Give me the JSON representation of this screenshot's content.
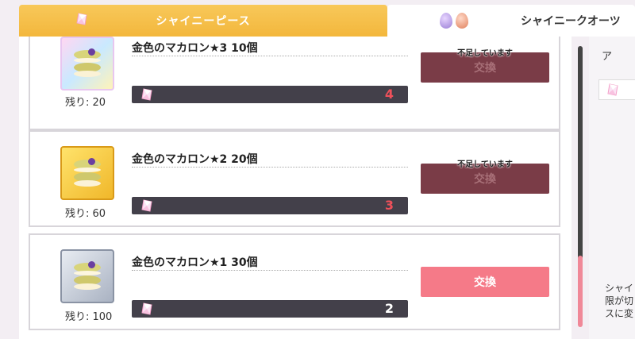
{
  "tabs": {
    "active_label": "シャイニーピース",
    "inactive_label": "シャイニークオーツ"
  },
  "items": [
    {
      "name": "金色のマカロン★3 10個",
      "remaining": "残り: 20",
      "cost": "4",
      "button_label": "交換",
      "shortage_label": "不足しています",
      "thumb_icon": "gold-macaron-3star-icon"
    },
    {
      "name": "金色のマカロン★2 20個",
      "remaining": "残り: 60",
      "cost": "3",
      "button_label": "交換",
      "shortage_label": "不足しています",
      "thumb_icon": "gold-macaron-2star-icon"
    },
    {
      "name": "金色のマカロン★1 30個",
      "remaining": "残り: 100",
      "cost": "2",
      "button_label": "交換",
      "thumb_icon": "gold-macaron-1star-icon"
    }
  ],
  "side": {
    "top_label": "ア",
    "text_line1": "シャイ",
    "text_line2": "限が切",
    "text_line3": "スに変"
  },
  "colors": {
    "tab_active": "#f3b73c",
    "button_enabled": "#f57a88",
    "button_disabled": "#7a3c47",
    "insufficient_cost": "#f0505a",
    "scroll_thumb": "#f08898"
  }
}
